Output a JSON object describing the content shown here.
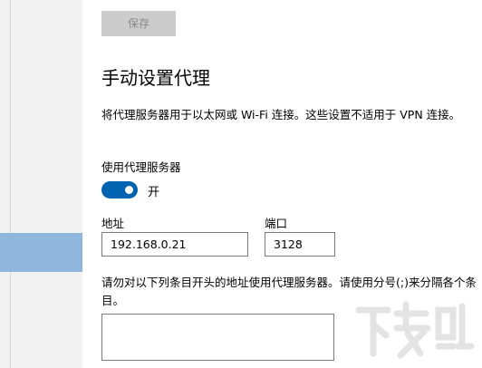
{
  "toolbar": {
    "save_label": "保存"
  },
  "proxy": {
    "title": "手动设置代理",
    "description": "将代理服务器用于以太网或 Wi-Fi 连接。这些设置不适用于 VPN 连接。",
    "use_proxy_label": "使用代理服务器",
    "toggle_state": "开",
    "toggle_on": true,
    "address_label": "地址",
    "address_value": "192.168.0.21",
    "port_label": "端口",
    "port_value": "3128",
    "exceptions_description": "请勿对以下列条目开头的地址使用代理服务器。请使用分号(;)来分隔各个条目。",
    "exceptions_value": ""
  },
  "watermark": {
    "text": "下载吧"
  },
  "colors": {
    "accent": "#0063b1",
    "sidebar_selected": "#8fb6dc",
    "disabled_button": "#cccccc"
  }
}
